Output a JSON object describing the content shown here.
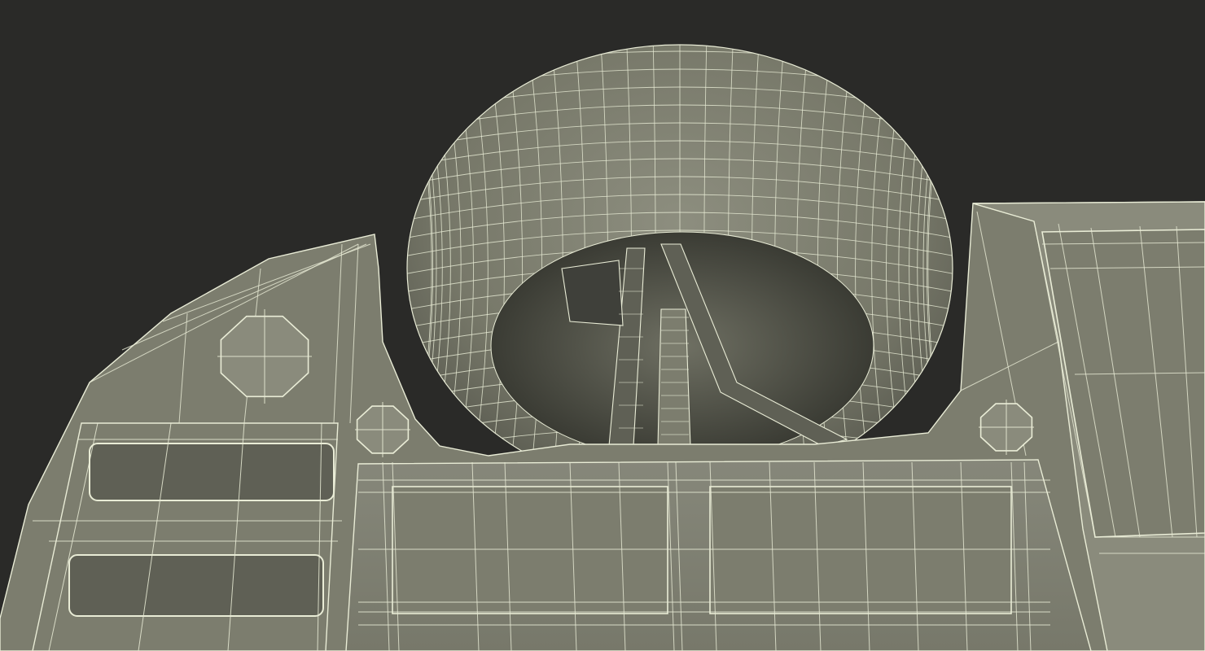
{
  "scene": {
    "subject": "wireframe-3d-model-render",
    "colors": {
      "background": "#2a2a28",
      "surface": "#7c7d6e",
      "surface_light": "#8a8b7c",
      "surface_dark": "#5f6055",
      "shadow": "#3f403a",
      "wire": "#e9ecd6"
    }
  }
}
